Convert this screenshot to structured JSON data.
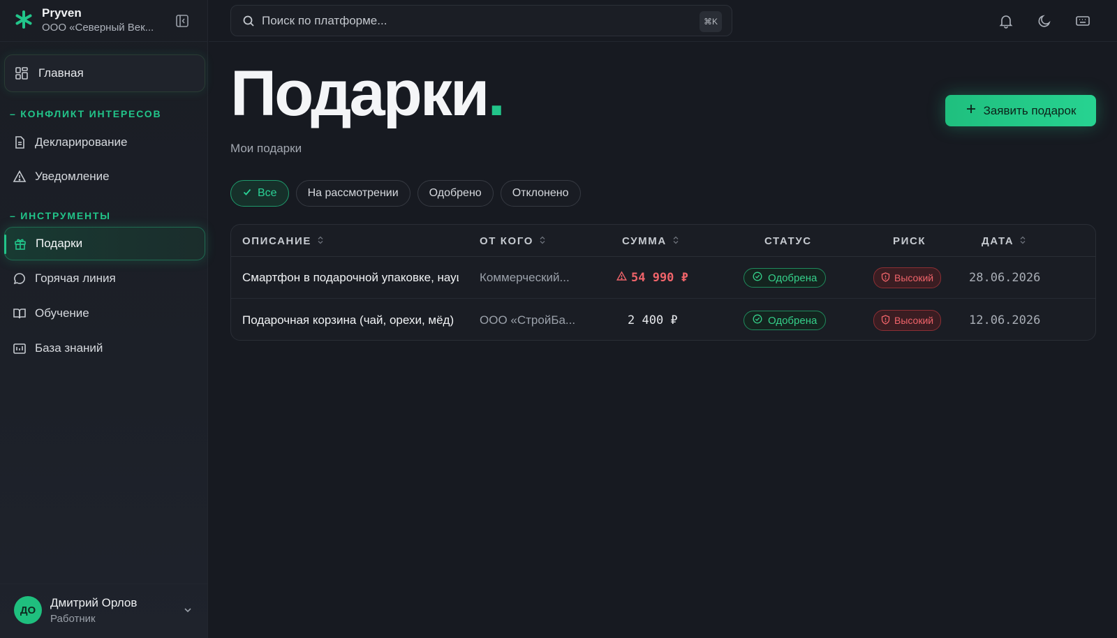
{
  "colors": {
    "accent": "#22c58a",
    "danger": "#f0646a",
    "background": "#171a21"
  },
  "brand": {
    "name": "Pryven",
    "org": "ООО «Северный Век..."
  },
  "sidebar": {
    "home": {
      "label": "Главная",
      "icon": "grid-icon"
    },
    "sections": [
      {
        "title": "– КОНФЛИКТ ИНТЕРЕСОВ"
      },
      {
        "title": "– ИНСТРУМЕНТЫ"
      }
    ],
    "items": [
      {
        "label": "Декларирование",
        "icon": "document-icon"
      },
      {
        "label": "Уведомление",
        "icon": "warning-icon"
      },
      {
        "label": "Подарки",
        "icon": "gift-icon",
        "active": true
      },
      {
        "label": "Горячая линия",
        "icon": "chat-icon"
      },
      {
        "label": "Обучение",
        "icon": "book-icon"
      },
      {
        "label": "База знаний",
        "icon": "chart-icon"
      }
    ]
  },
  "user": {
    "initials": "ДО",
    "name": "Дмитрий Орлов",
    "role": "Работник"
  },
  "search": {
    "placeholder": "Поиск по платформе...",
    "shortcut": "⌘K"
  },
  "topbar": {
    "icons": [
      "bell-icon",
      "moon-icon",
      "keyboard-icon"
    ]
  },
  "page": {
    "title": "Подарки",
    "title_dot": ".",
    "subtitle": "Мои подарки",
    "cta": "Заявить подарок"
  },
  "filters": [
    {
      "label": "Все",
      "active": true
    },
    {
      "label": "На рассмотрении"
    },
    {
      "label": "Одобрено"
    },
    {
      "label": "Отклонено"
    }
  ],
  "table": {
    "columns": [
      "ОПИСАНИЕ",
      "ОТ КОГО",
      "СУММА",
      "СТАТУС",
      "РИСК",
      "ДАТА"
    ],
    "rows": [
      {
        "description": "Смартфон в подарочной упаковке, наушники",
        "from": "Коммерческий...",
        "amount": "54 990 ₽",
        "amount_warning": true,
        "status": "Одобрена",
        "risk": "Высокий",
        "date": "28.06.2026"
      },
      {
        "description": "Подарочная корзина (чай, орехи, мёд)",
        "from": "ООО «СтройБа...",
        "amount": "2 400 ₽",
        "amount_warning": false,
        "status": "Одобрена",
        "risk": "Высокий",
        "date": "12.06.2026"
      }
    ]
  }
}
